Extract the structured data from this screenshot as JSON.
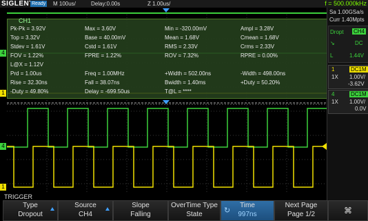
{
  "topbar": {
    "brand": "SIGLENT",
    "status": "Ready",
    "timebase": "M 100us/",
    "delay": "Delay:0.00s",
    "zoom": "Z 1.00us/",
    "frequency": "f = 500.000kHz"
  },
  "acquisition": {
    "sample_rate": "Sa 1.00GSa/s",
    "memory": "Curr 1.40Mpts",
    "trigger_source_label": "Dropt",
    "trigger_channel": "CH4",
    "coupling": "DC",
    "level_label": "L",
    "level_value": "1.44V"
  },
  "channels": [
    {
      "num": "1",
      "coupling": "DC1M",
      "probe": "1X",
      "scale": "1.00V/",
      "offset": "-3.62V",
      "color": "#f0e000"
    },
    {
      "num": "4",
      "coupling": "DC1M",
      "probe": "1X",
      "scale": "1.00V/",
      "offset": "0.0V",
      "color": "#3cd23c"
    }
  ],
  "measure": {
    "title": "CH1",
    "rows": [
      [
        "Pk-Pk = 3.92V",
        "Max = 3.60V",
        "Min = -320.00mV",
        "Ampl = 3.28V"
      ],
      [
        "Top = 3.32V",
        "Base = 40.00mV",
        "Mean = 1.68V",
        "Cmean = 1.68V"
      ],
      [
        "Stdev = 1.61V",
        "Cstd = 1.61V",
        "RMS = 2.33V",
        "Crms = 2.33V"
      ],
      [
        "FOV = 1.22%",
        "FPRE = 1.22%",
        "ROV = 7.32%",
        "RPRE = 0.00%"
      ],
      [
        "L@X = 1.12V",
        "",
        "",
        ""
      ],
      [
        "Prd = 1.00us",
        "Freq = 1.00MHz",
        "+Width = 502.00ns",
        "-Width = 498.00ns"
      ],
      [
        "Rise = 32.30ns",
        "Fall = 38.07ns",
        "Bwidth = 1.40ms",
        "+Duty = 50.20%"
      ],
      [
        "-Duty = 49.80%",
        "Delay = -699.50us",
        "T@L = ****",
        ""
      ]
    ]
  },
  "markers": {
    "ch4": "4",
    "ch1": "1"
  },
  "menu": {
    "title": "TRIGGER",
    "buttons": [
      {
        "l1": "Type",
        "l2": "Dropout"
      },
      {
        "l1": "Source",
        "l2": "CH4"
      },
      {
        "l1": "Slope",
        "l2": "Falling"
      },
      {
        "l1": "OverTime Type",
        "l2": "State"
      },
      {
        "l1": "Time",
        "l2": "997ns"
      },
      {
        "l1": "Next Page",
        "l2": "Page 1/2"
      }
    ]
  }
}
